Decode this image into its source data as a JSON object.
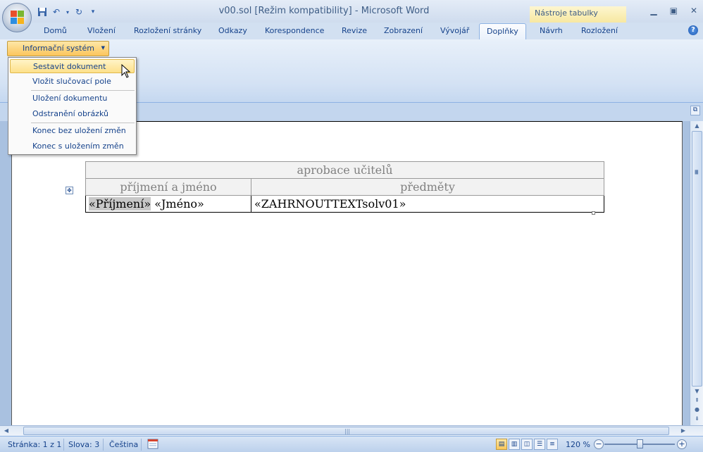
{
  "window": {
    "title": "v00.sol [Režim kompatibility] - Microsoft Word",
    "context_tab": "Nástroje tabulky"
  },
  "quick_access": [
    "save-icon",
    "undo-icon",
    "redo-icon",
    "customize-icon"
  ],
  "tabs": [
    {
      "label": "Domů"
    },
    {
      "label": "Vložení"
    },
    {
      "label": "Rozložení stránky"
    },
    {
      "label": "Odkazy"
    },
    {
      "label": "Korespondence"
    },
    {
      "label": "Revize"
    },
    {
      "label": "Zobrazení"
    },
    {
      "label": "Vývojář"
    },
    {
      "label": "Doplňky",
      "active": true
    },
    {
      "label": "Návrh"
    },
    {
      "label": "Rozložení"
    }
  ],
  "ribbon": {
    "tool_label": "Informační systém"
  },
  "menu": {
    "items": [
      {
        "label": "Sestavit dokument",
        "highlighted": true
      },
      {
        "label": "Vložit slučovací pole"
      },
      {
        "label": "Uložení dokumentu"
      },
      {
        "label": "Odstranění obrázků"
      },
      {
        "label": "Konec bez uložení změn"
      },
      {
        "label": "Konec s uložením změn"
      }
    ]
  },
  "document": {
    "table": {
      "title": "aprobace učitelů",
      "col1_header": "příjmení a jméno",
      "col2_header": "předměty",
      "row": {
        "field_surname": "«Příjmení»",
        "field_name": " «Jméno»",
        "field_subjects": "«ZAHRNOUTTEXTsolv01»"
      }
    }
  },
  "status": {
    "page": "Stránka: 1 z 1",
    "words": "Slova: 3",
    "language": "Čeština",
    "zoom": "120 %"
  }
}
